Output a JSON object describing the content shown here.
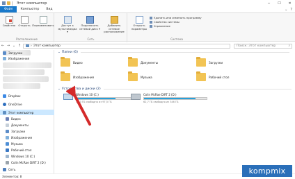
{
  "titlebar": {
    "title": "Этот компьютер"
  },
  "menu": {
    "tabs": [
      "Файл",
      "Компьютер",
      "Вид"
    ]
  },
  "ribbon": {
    "location_group": {
      "label": "Расположение",
      "buttons": [
        "Свойства",
        "Открыть",
        "Переименовать"
      ]
    },
    "network_group": {
      "label": "Сеть",
      "buttons": [
        "Доступ к мультимедиа ▾",
        "Подключить сетевой диск ▾",
        "Добавить сетевое расположение"
      ]
    },
    "system_group": {
      "label": "Система",
      "open_params": "Открыть параметры",
      "items": [
        "Удалить или изменить программу",
        "Свойства системы",
        "Управление"
      ]
    }
  },
  "address": {
    "path": "Этот компьютер",
    "search_placeholder": "Поиск: Этот компьютер"
  },
  "sidebar": {
    "items": [
      "Загрузки",
      "Изображения",
      "Dropbox",
      "OneDrive",
      "Этот компьютер",
      "Видео",
      "Документы",
      "Загрузки",
      "Изображения",
      "Музыка",
      "Рабочий стол",
      "Windows 10 (C:)",
      "Colin McRae DiRT 2 (D:)",
      "Сеть"
    ]
  },
  "content": {
    "folders_header": "Папки (6)",
    "folders": [
      "Видео",
      "Документы",
      "Загрузки",
      "Изображения",
      "Музыка",
      "Рабочий стол"
    ],
    "drives_header": "Устройства и диски (2)",
    "drives": [
      {
        "name": "Windows 10 (C:)",
        "free": "37,0 ГБ свободно из 97,5 ГБ",
        "used_fraction": 0.62
      },
      {
        "name": "Colin McRae DiRT 2 (D:)",
        "free": "62,7 ГБ свободно из 346 ГБ",
        "used_fraction": 0.82
      }
    ]
  },
  "status": {
    "text": "Элементов: 8"
  },
  "brand": {
    "text": "kompmix"
  },
  "colors": {
    "accent": "#1979ca",
    "arrow": "#d42a2a",
    "brand": "#2a6fb9"
  }
}
